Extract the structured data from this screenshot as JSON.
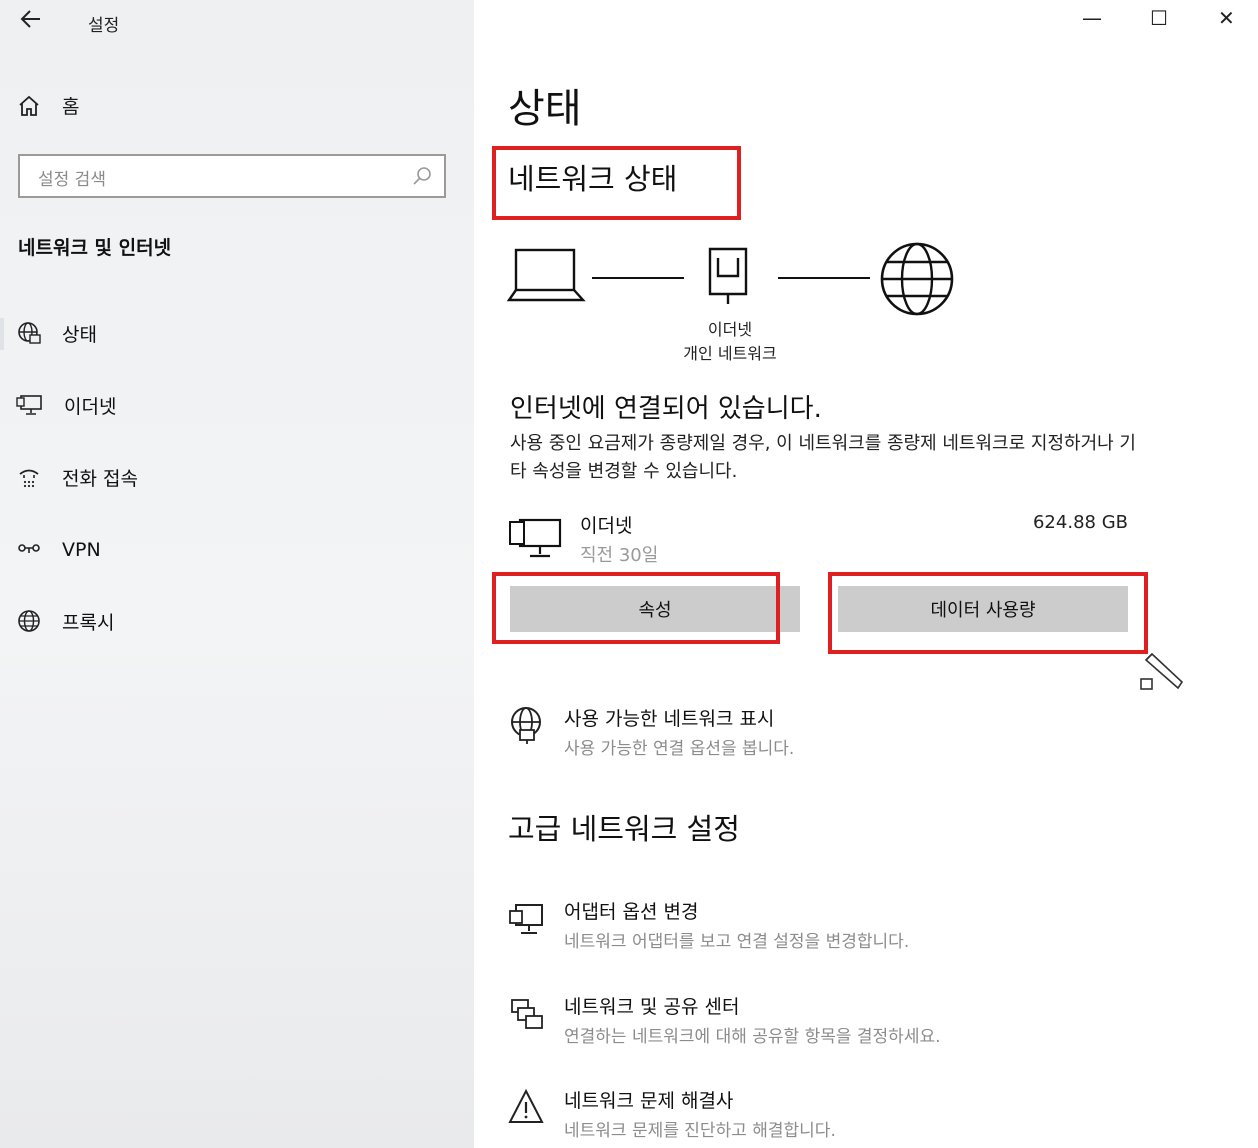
{
  "window": {
    "title": "설정",
    "back_icon": "back-arrow-icon",
    "controls": {
      "minimize": "—",
      "maximize": "☐",
      "close": "✕"
    }
  },
  "sidebar": {
    "home_label": "홈",
    "search_placeholder": "설정 검색",
    "section_title": "네트워크 및 인터넷",
    "items": [
      {
        "label": "상태",
        "icon": "status-globe-icon",
        "active": true
      },
      {
        "label": "이더넷",
        "icon": "ethernet-icon"
      },
      {
        "label": "전화 접속",
        "icon": "dialup-icon"
      },
      {
        "label": "VPN",
        "icon": "vpn-icon"
      },
      {
        "label": "프록시",
        "icon": "proxy-globe-icon"
      }
    ]
  },
  "main": {
    "page_title": "상태",
    "network_status_heading": "네트워크 상태",
    "diagram": {
      "adapter_label": "이더넷",
      "network_label": "개인 네트워크"
    },
    "connection_title": "인터넷에 연결되어 있습니다.",
    "connection_desc": "사용 중인 요금제가 종량제일 경우, 이 네트워크를 종량제 네트워크로 지정하거나 기타 속성을 변경할 수 있습니다.",
    "ethernet": {
      "name": "이더넷",
      "period": "직전 30일",
      "usage": "624.88 GB"
    },
    "buttons": {
      "properties": "속성",
      "data_usage": "데이터 사용량"
    },
    "show_networks": {
      "title": "사용 가능한 네트워크 표시",
      "desc": "사용 가능한 연결 옵션을 봅니다."
    },
    "advanced_heading": "고급 네트워크 설정",
    "advanced_items": [
      {
        "title": "어댑터 옵션 변경",
        "desc": "네트워크 어댑터를 보고 연결 설정을 변경합니다.",
        "icon": "adapter-icon"
      },
      {
        "title": "네트워크 및 공유 센터",
        "desc": "연결하는 네트워크에 대해 공유할 항목을 결정하세요.",
        "icon": "sharing-center-icon"
      },
      {
        "title": "네트워크 문제 해결사",
        "desc": "네트워크 문제를 진단하고 해결합니다.",
        "icon": "warning-icon"
      }
    ]
  },
  "colors": {
    "highlight_box": "#e02020",
    "button_bg": "#cccccc",
    "secondary_text": "#8c8c8c"
  }
}
